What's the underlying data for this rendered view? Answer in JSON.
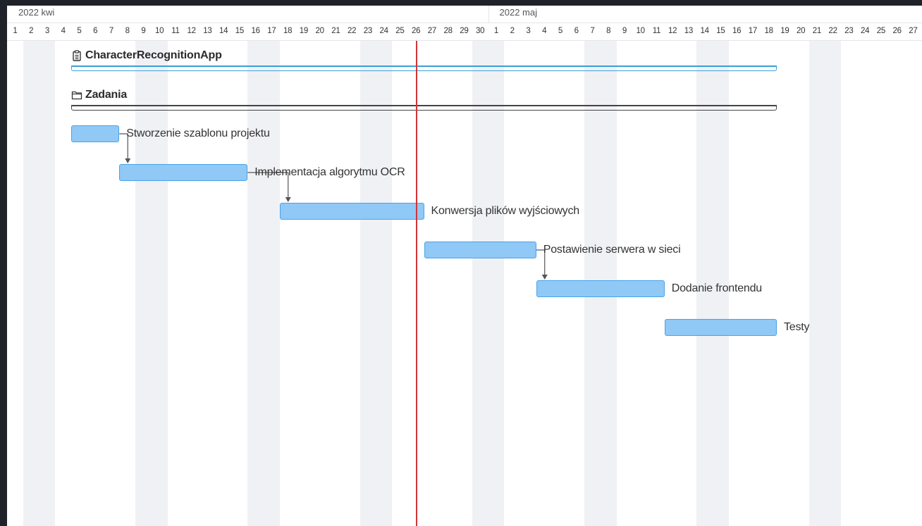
{
  "timeline": {
    "months": [
      {
        "label": "2022 kwi",
        "days": 30
      },
      {
        "label": "2022 maj",
        "days": 27
      }
    ],
    "today": {
      "month": "2022 kwi",
      "day": 26
    },
    "weekends": [
      {
        "month": "2022 kwi",
        "days": [
          2,
          3
        ]
      },
      {
        "month": "2022 kwi",
        "days": [
          9,
          10
        ]
      },
      {
        "month": "2022 kwi",
        "days": [
          16,
          17
        ]
      },
      {
        "month": "2022 kwi",
        "days": [
          23,
          24
        ]
      },
      {
        "month": "2022 kwi",
        "days": [
          30
        ]
      },
      {
        "month": "2022 maj",
        "days": [
          1
        ]
      },
      {
        "month": "2022 maj",
        "days": [
          7,
          8
        ]
      },
      {
        "month": "2022 maj",
        "days": [
          14,
          15
        ]
      },
      {
        "month": "2022 maj",
        "days": [
          21,
          22
        ]
      }
    ]
  },
  "groups": [
    {
      "title": "CharacterRecognitionApp",
      "icon": "clipboard-icon",
      "color": "#3aa0d8",
      "start": {
        "month": "2022 kwi",
        "day": 5
      },
      "end": {
        "month": "2022 maj",
        "day": 19
      }
    },
    {
      "title": "Zadania",
      "icon": "folder-icon",
      "color": "#444444",
      "start": {
        "month": "2022 kwi",
        "day": 5
      },
      "end": {
        "month": "2022 maj",
        "day": 19
      }
    }
  ],
  "tasks": [
    {
      "name": "Stworzenie szablonu projektu",
      "start": {
        "month": "2022 kwi",
        "day": 5
      },
      "end": {
        "month": "2022 kwi",
        "day": 7
      }
    },
    {
      "name": "Implementacja algorytmu OCR",
      "start": {
        "month": "2022 kwi",
        "day": 8
      },
      "end": {
        "month": "2022 kwi",
        "day": 15
      }
    },
    {
      "name": "Konwersja plików wyjściowych",
      "start": {
        "month": "2022 kwi",
        "day": 18
      },
      "end": {
        "month": "2022 kwi",
        "day": 26
      }
    },
    {
      "name": "Postawienie serwera w sieci",
      "start": {
        "month": "2022 kwi",
        "day": 27
      },
      "end": {
        "month": "2022 maj",
        "day": 3
      }
    },
    {
      "name": "Dodanie frontendu",
      "start": {
        "month": "2022 maj",
        "day": 4
      },
      "end": {
        "month": "2022 maj",
        "day": 11
      }
    },
    {
      "name": "Testy",
      "start": {
        "month": "2022 maj",
        "day": 12
      },
      "end": {
        "month": "2022 maj",
        "day": 18
      }
    }
  ],
  "dependencies": [
    {
      "from": "Stworzenie szablonu projektu",
      "to": "Implementacja algorytmu OCR"
    },
    {
      "from": "Implementacja algorytmu OCR",
      "to": "Konwersja plików wyjściowych"
    },
    {
      "from": "Postawienie serwera w sieci",
      "to": "Dodanie frontendu"
    }
  ],
  "colors": {
    "bar_fill": "#90c8f6",
    "bar_border": "#4aa3e8",
    "today_line": "#d13438",
    "weekend_band": "#f0f1f5",
    "frame": "#1f2329"
  }
}
